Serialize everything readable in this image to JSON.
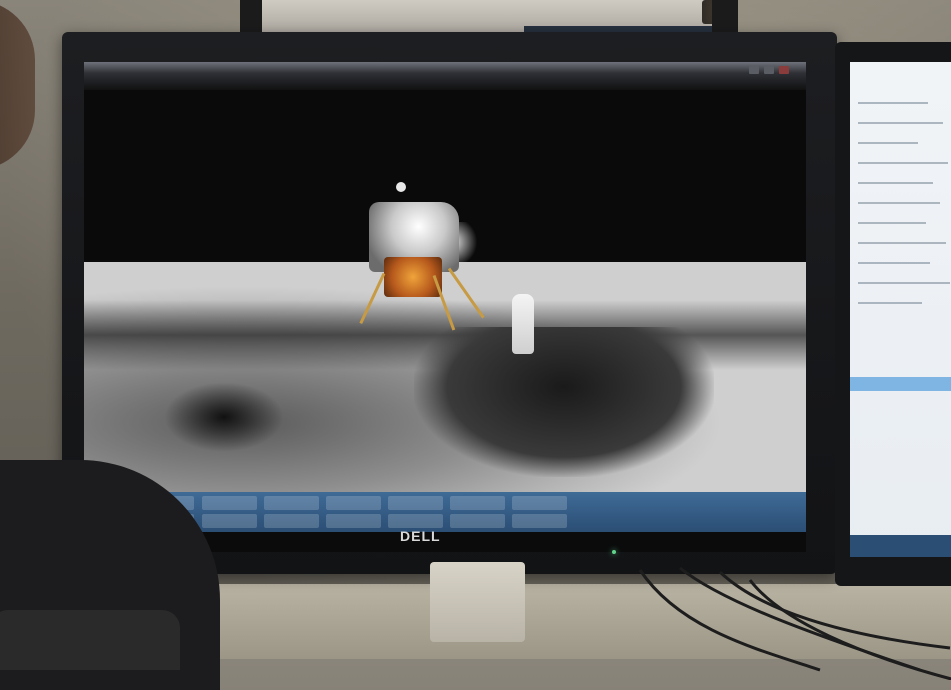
{
  "scene": {
    "type": "photo",
    "monitor": {
      "brand_logo": "DELL",
      "window_title": ""
    },
    "colors": {
      "taskbar": "#2b4e74",
      "power_led": "#60d48b",
      "moon_surface": "#cfcfcf"
    }
  }
}
